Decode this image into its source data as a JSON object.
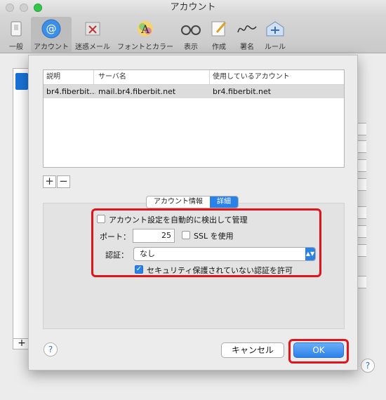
{
  "window": {
    "title": "アカウント"
  },
  "toolbar": {
    "items": [
      {
        "label": "一般",
        "icon": "switch-icon"
      },
      {
        "label": "アカウント",
        "icon": "at-sign-icon"
      },
      {
        "label": "迷惑メール",
        "icon": "trash-junk-icon"
      },
      {
        "label": "フォントとカラー",
        "icon": "font-color-icon"
      },
      {
        "label": "表示",
        "icon": "glasses-icon"
      },
      {
        "label": "作成",
        "icon": "pencil-icon"
      },
      {
        "label": "署名",
        "icon": "signature-icon"
      },
      {
        "label": "ルール",
        "icon": "rules-icon"
      }
    ]
  },
  "table": {
    "columns": [
      "説明",
      "サーバ名",
      "使用しているアカウント"
    ],
    "rows": [
      {
        "description": "br4.fiberbit...",
        "server": "mail.br4.fiberbit.net",
        "account": "br4.fiberbit.net"
      }
    ]
  },
  "list_controls": {
    "add": "+",
    "remove": "−"
  },
  "tabs": [
    "アカウント情報",
    "詳細"
  ],
  "advanced": {
    "auto_detect_label": "アカウント設定を自動的に検出して管理",
    "port_label": "ポート：",
    "port_value": "25",
    "ssl_label": "SSL を使用",
    "auth_label": "認証：",
    "auth_value": "なし",
    "insecure_auth_label": "セキュリティ保護されていない認証を許可"
  },
  "buttons": {
    "help": "?",
    "cancel": "キャンセル",
    "ok": "OK"
  },
  "background": {
    "add": "+",
    "help": "?"
  },
  "colors": {
    "accent": "#2b82e6",
    "highlight": "#e1141c"
  }
}
